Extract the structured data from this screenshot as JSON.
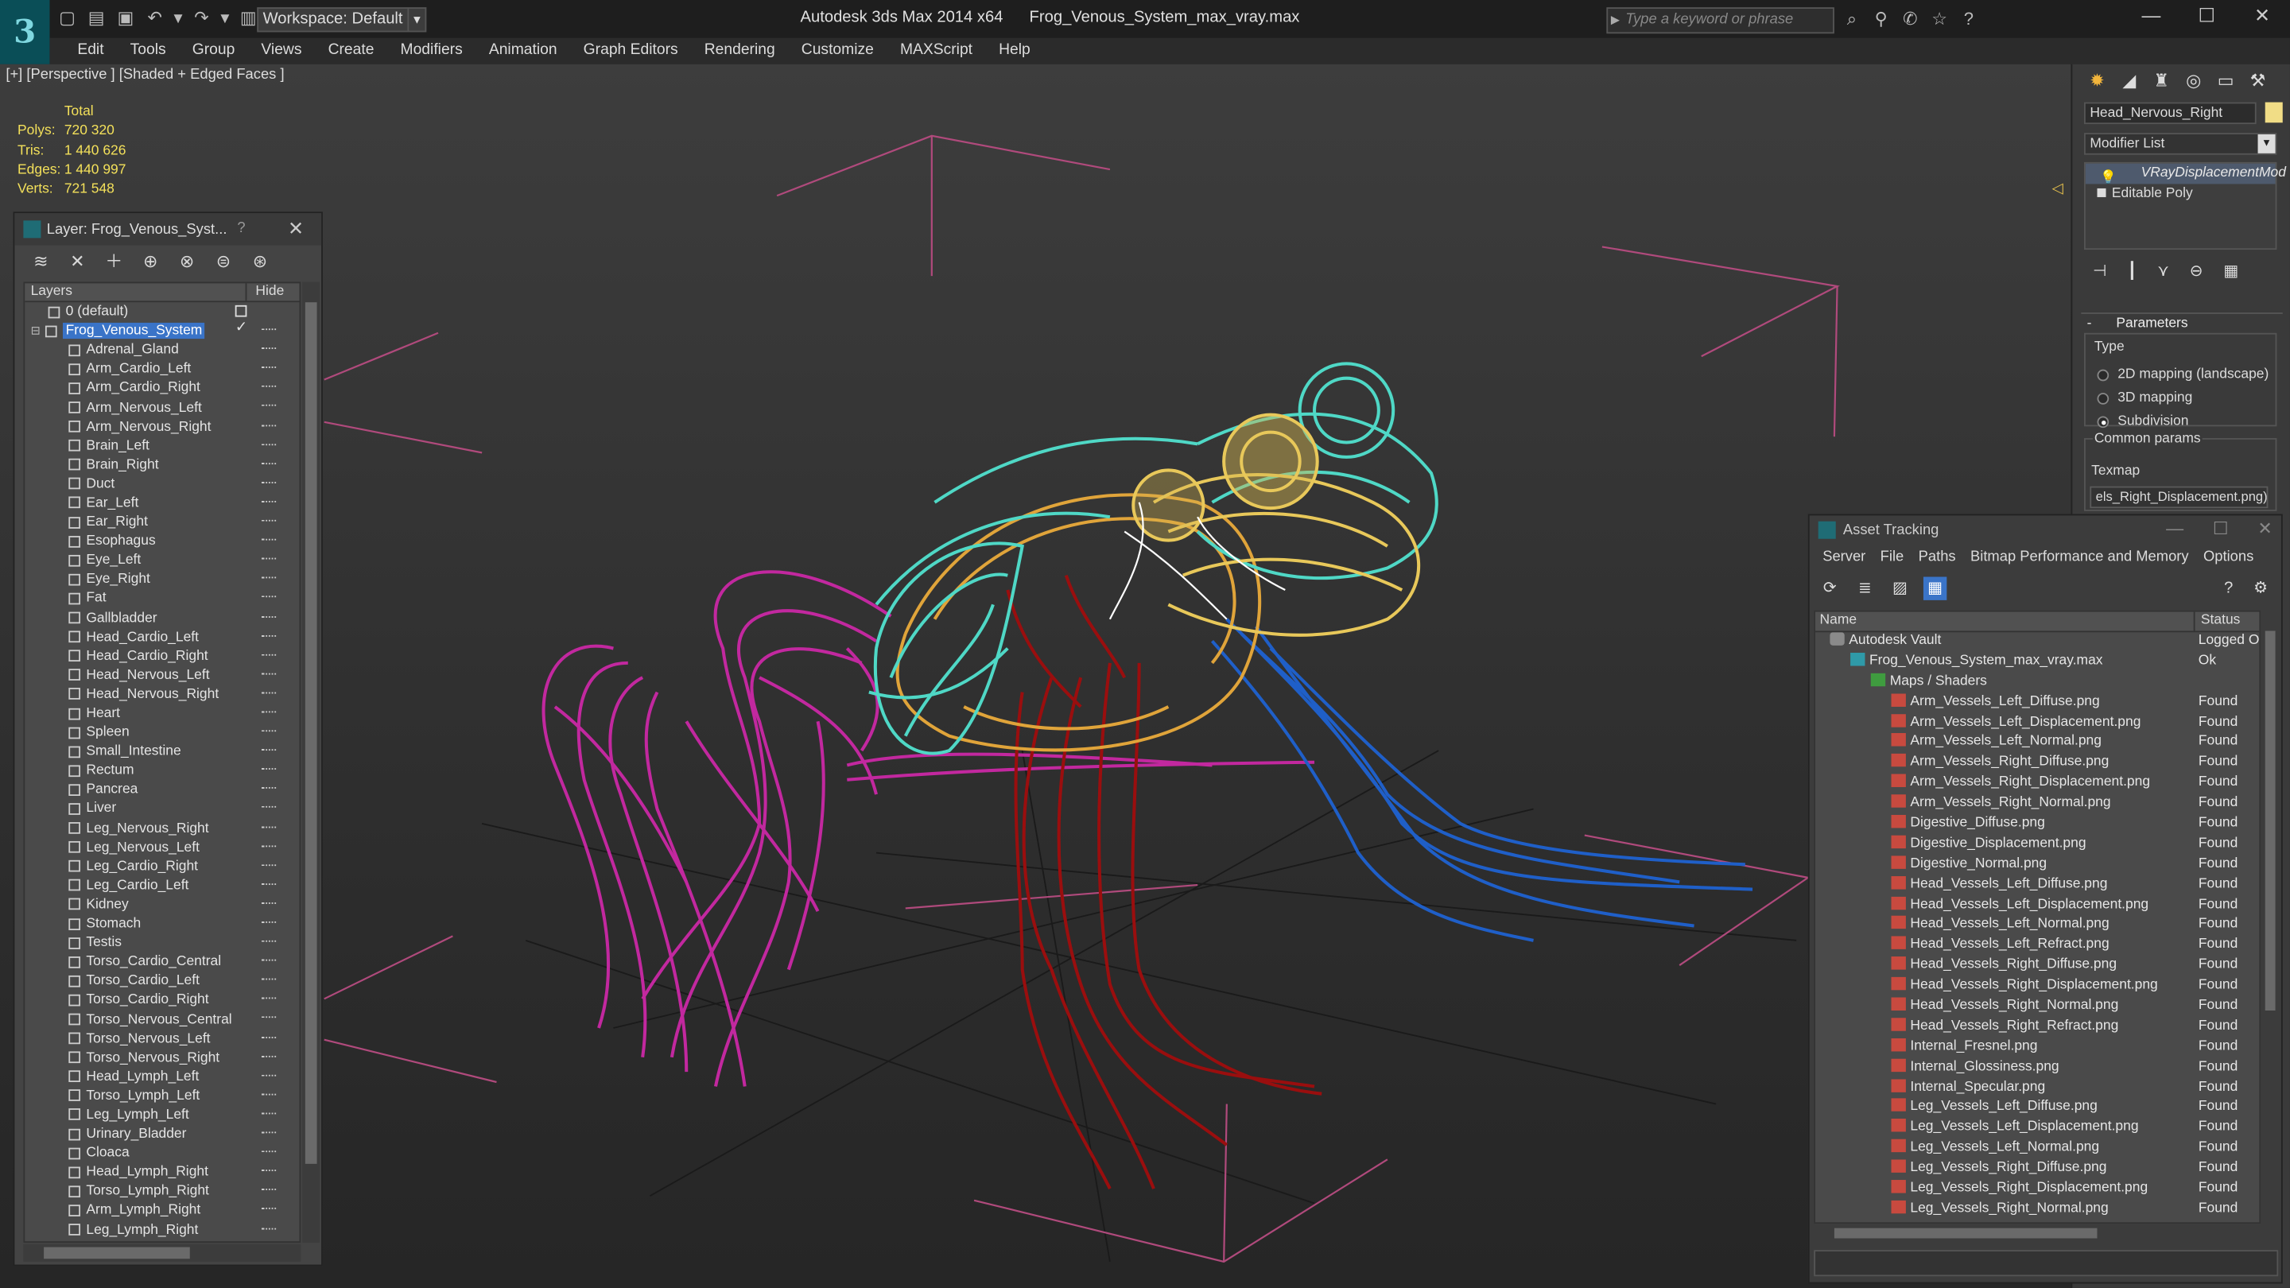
{
  "app": {
    "name": "Autodesk 3ds Max 2014 x64",
    "file": "Frog_Venous_System_max_vray.max",
    "workspace": "Workspace: Default",
    "search_placeholder": "Type a keyword or phrase"
  },
  "menu": [
    "Edit",
    "Tools",
    "Group",
    "Views",
    "Create",
    "Modifiers",
    "Animation",
    "Graph Editors",
    "Rendering",
    "Customize",
    "MAXScript",
    "Help"
  ],
  "viewport": {
    "label": "[+] [Perspective ] [Shaded + Edged Faces ]",
    "stats_header": "Total",
    "stats": [
      {
        "k": "Polys:",
        "v": "720 320"
      },
      {
        "k": "Tris:",
        "v": "1 440 626"
      },
      {
        "k": "Edges:",
        "v": "1 440 997"
      },
      {
        "k": "Verts:",
        "v": "721 548"
      }
    ]
  },
  "layer_panel": {
    "title": "Layer: Frog_Venous_Syst...",
    "help": "?",
    "col_layers": "Layers",
    "col_hide": "Hide",
    "default_layer": "0 (default)",
    "selected_layer": "Frog_Venous_System",
    "items": [
      "Adrenal_Gland",
      "Arm_Cardio_Left",
      "Arm_Cardio_Right",
      "Arm_Nervous_Left",
      "Arm_Nervous_Right",
      "Brain_Left",
      "Brain_Right",
      "Duct",
      "Ear_Left",
      "Ear_Right",
      "Esophagus",
      "Eye_Left",
      "Eye_Right",
      "Fat",
      "Gallbladder",
      "Head_Cardio_Left",
      "Head_Cardio_Right",
      "Head_Nervous_Left",
      "Head_Nervous_Right",
      "Heart",
      "Spleen",
      "Small_Intestine",
      "Rectum",
      "Pancrea",
      "Liver",
      "Leg_Nervous_Right",
      "Leg_Nervous_Left",
      "Leg_Cardio_Right",
      "Leg_Cardio_Left",
      "Kidney",
      "Stomach",
      "Testis",
      "Torso_Cardio_Central",
      "Torso_Cardio_Left",
      "Torso_Cardio_Right",
      "Torso_Nervous_Central",
      "Torso_Nervous_Left",
      "Torso_Nervous_Right",
      "Head_Lymph_Left",
      "Torso_Lymph_Left",
      "Leg_Lymph_Left",
      "Urinary_Bladder",
      "Cloaca",
      "Head_Lymph_Right",
      "Torso_Lymph_Right",
      "Arm_Lymph_Right",
      "Leg_Lymph_Right"
    ]
  },
  "command_panel": {
    "object_name": "Head_Nervous_Right",
    "modifier_list": "Modifier List",
    "stack": [
      "VRayDisplacementMod",
      "Editable Poly"
    ],
    "rollout": "Parameters",
    "type_label": "Type",
    "radios": [
      {
        "label": "2D mapping (landscape)",
        "on": false
      },
      {
        "label": "3D mapping",
        "on": false
      },
      {
        "label": "Subdivision",
        "on": true
      }
    ],
    "common_label": "Common params",
    "texmap_label": "Texmap",
    "texmap_value": "els_Right_Displacement.png)"
  },
  "asset_tracking": {
    "title": "Asset Tracking",
    "menu": [
      "Server",
      "File",
      "Paths",
      "Bitmap Performance and Memory",
      "Options"
    ],
    "col_name": "Name",
    "col_status": "Status",
    "rows": [
      {
        "name": "Autodesk Vault",
        "status": "Logged Out",
        "icon": "vault",
        "indent": 1
      },
      {
        "name": "Frog_Venous_System_max_vray.max",
        "status": "Ok",
        "icon": "max",
        "indent": 2
      },
      {
        "name": "Maps / Shaders",
        "status": "",
        "icon": "folder",
        "indent": 3
      },
      {
        "name": "Arm_Vessels_Left_Diffuse.png",
        "status": "Found",
        "icon": "png",
        "indent": 4
      },
      {
        "name": "Arm_Vessels_Left_Displacement.png",
        "status": "Found",
        "icon": "png",
        "indent": 4
      },
      {
        "name": "Arm_Vessels_Left_Normal.png",
        "status": "Found",
        "icon": "png",
        "indent": 4
      },
      {
        "name": "Arm_Vessels_Right_Diffuse.png",
        "status": "Found",
        "icon": "png",
        "indent": 4
      },
      {
        "name": "Arm_Vessels_Right_Displacement.png",
        "status": "Found",
        "icon": "png",
        "indent": 4
      },
      {
        "name": "Arm_Vessels_Right_Normal.png",
        "status": "Found",
        "icon": "png",
        "indent": 4
      },
      {
        "name": "Digestive_Diffuse.png",
        "status": "Found",
        "icon": "png",
        "indent": 4
      },
      {
        "name": "Digestive_Displacement.png",
        "status": "Found",
        "icon": "png",
        "indent": 4
      },
      {
        "name": "Digestive_Normal.png",
        "status": "Found",
        "icon": "png",
        "indent": 4
      },
      {
        "name": "Head_Vessels_Left_Diffuse.png",
        "status": "Found",
        "icon": "png",
        "indent": 4
      },
      {
        "name": "Head_Vessels_Left_Displacement.png",
        "status": "Found",
        "icon": "png",
        "indent": 4
      },
      {
        "name": "Head_Vessels_Left_Normal.png",
        "status": "Found",
        "icon": "png",
        "indent": 4
      },
      {
        "name": "Head_Vessels_Left_Refract.png",
        "status": "Found",
        "icon": "png",
        "indent": 4
      },
      {
        "name": "Head_Vessels_Right_Diffuse.png",
        "status": "Found",
        "icon": "png",
        "indent": 4
      },
      {
        "name": "Head_Vessels_Right_Displacement.png",
        "status": "Found",
        "icon": "png",
        "indent": 4
      },
      {
        "name": "Head_Vessels_Right_Normal.png",
        "status": "Found",
        "icon": "png",
        "indent": 4
      },
      {
        "name": "Head_Vessels_Right_Refract.png",
        "status": "Found",
        "icon": "png",
        "indent": 4
      },
      {
        "name": "Internal_Fresnel.png",
        "status": "Found",
        "icon": "png",
        "indent": 4
      },
      {
        "name": "Internal_Glossiness.png",
        "status": "Found",
        "icon": "png",
        "indent": 4
      },
      {
        "name": "Internal_Specular.png",
        "status": "Found",
        "icon": "png",
        "indent": 4
      },
      {
        "name": "Leg_Vessels_Left_Diffuse.png",
        "status": "Found",
        "icon": "png",
        "indent": 4
      },
      {
        "name": "Leg_Vessels_Left_Displacement.png",
        "status": "Found",
        "icon": "png",
        "indent": 4
      },
      {
        "name": "Leg_Vessels_Left_Normal.png",
        "status": "Found",
        "icon": "png",
        "indent": 4
      },
      {
        "name": "Leg_Vessels_Right_Diffuse.png",
        "status": "Found",
        "icon": "png",
        "indent": 4
      },
      {
        "name": "Leg_Vessels_Right_Displacement.png",
        "status": "Found",
        "icon": "png",
        "indent": 4
      },
      {
        "name": "Leg_Vessels_Right_Normal.png",
        "status": "Found",
        "icon": "png",
        "indent": 4
      }
    ]
  },
  "colors": {
    "stats": "#f3e05a",
    "selection": "#3a74c8",
    "frog_magenta": "#c2289f",
    "frog_cyan": "#4fd8c6",
    "frog_red": "#9a0e0e",
    "frog_blue": "#1f5fc8",
    "frog_yellow": "#e8c85a"
  }
}
